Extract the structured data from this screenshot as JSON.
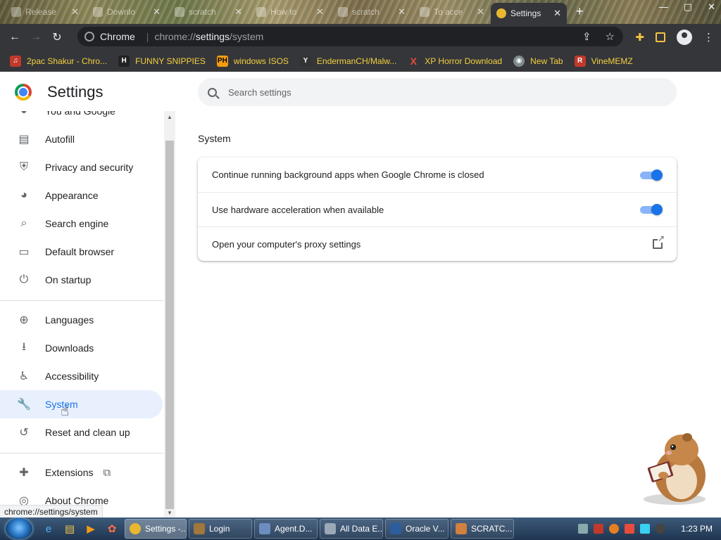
{
  "tabs": [
    {
      "label": "Release",
      "active": false
    },
    {
      "label": "Downlo",
      "active": false
    },
    {
      "label": "scratch",
      "active": false
    },
    {
      "label": "How to",
      "active": false
    },
    {
      "label": "scratch",
      "active": false
    },
    {
      "label": "To acce",
      "active": false
    },
    {
      "label": "Settings",
      "active": true
    }
  ],
  "tab_close_glyph": "✕",
  "new_tab_glyph": "+",
  "window_controls": {
    "minimize": "—",
    "maximize": "▢",
    "close": "✕"
  },
  "omnibox": {
    "site_label": "Chrome",
    "url_prefix": "chrome://",
    "url_host": "settings",
    "url_path": "/system"
  },
  "bookmarks": [
    {
      "label": "2pac Shakur - Chro...",
      "icon": "music-icon",
      "color": "#c0392b",
      "glyph": "♫"
    },
    {
      "label": "FUNNY SNIPPIES",
      "icon": "h-logo-icon",
      "color": "#222222",
      "glyph": "H"
    },
    {
      "label": "windows ISOS",
      "icon": "ph-logo-icon",
      "color": "#f39c12",
      "glyph": "PH"
    },
    {
      "label": "EndermanCH/Malw...",
      "icon": "github-icon",
      "color": "#333333",
      "glyph": "Y"
    },
    {
      "label": "XP Horror Download",
      "icon": "x-logo-icon",
      "color": "#e74c3c",
      "glyph": "X"
    },
    {
      "label": "New Tab",
      "icon": "globe-icon",
      "color": "#7f8c8d",
      "glyph": "◉"
    },
    {
      "label": "VineMEMZ",
      "icon": "r-logo-icon",
      "color": "#c0392b",
      "glyph": "R"
    }
  ],
  "settings": {
    "title": "Settings",
    "search_placeholder": "Search settings",
    "section_title": "System"
  },
  "sidebar": {
    "items": [
      {
        "label": "You and Google",
        "icon": "person-icon",
        "glyph": "●"
      },
      {
        "label": "Autofill",
        "icon": "clipboard-icon",
        "glyph": "▤"
      },
      {
        "label": "Privacy and security",
        "icon": "shield-icon",
        "glyph": "⛨"
      },
      {
        "label": "Appearance",
        "icon": "palette-icon",
        "glyph": "◕"
      },
      {
        "label": "Search engine",
        "icon": "search-icon",
        "glyph": "⌕"
      },
      {
        "label": "Default browser",
        "icon": "browser-icon",
        "glyph": "▭"
      },
      {
        "label": "On startup",
        "icon": "power-icon",
        "glyph": "⏻"
      },
      {
        "label": "Languages",
        "icon": "globe-icon",
        "glyph": "⊕"
      },
      {
        "label": "Downloads",
        "icon": "download-icon",
        "glyph": "⭳"
      },
      {
        "label": "Accessibility",
        "icon": "accessibility-icon",
        "glyph": "♿"
      },
      {
        "label": "System",
        "icon": "wrench-icon",
        "glyph": "🔧"
      },
      {
        "label": "Reset and clean up",
        "icon": "history-icon",
        "glyph": "↺"
      },
      {
        "label": "Extensions",
        "icon": "puzzle-icon",
        "glyph": "✚"
      },
      {
        "label": "About Chrome",
        "icon": "chrome-icon",
        "glyph": "◎"
      }
    ],
    "active": "System"
  },
  "system_rows": [
    {
      "label": "Continue running background apps when Google Chrome is closed",
      "control": "toggle",
      "enabled": true
    },
    {
      "label": "Use hardware acceleration when available",
      "control": "toggle",
      "enabled": true
    },
    {
      "label": "Open your computer's proxy settings",
      "control": "external-link"
    }
  ],
  "status_url": "chrome://settings/system",
  "taskbar": {
    "tasks": [
      {
        "label": "Settings -...",
        "color": "#e8b730",
        "active": true
      },
      {
        "label": "Login",
        "color": "#a0773c",
        "active": false
      },
      {
        "label": "Agent.D...",
        "color": "#6c8ebf",
        "active": false
      },
      {
        "label": "All Data E...",
        "color": "#9aa8b8",
        "active": false
      },
      {
        "label": "Oracle V...",
        "color": "#2c5d9e",
        "active": false
      },
      {
        "label": "SCRATC...",
        "color": "#d08040",
        "active": false
      }
    ],
    "clock": "1:23 PM"
  },
  "colors": {
    "accent": "#1a73e8",
    "active_bg": "#e8f0fe",
    "toggle_track": "#8ab4f8"
  }
}
